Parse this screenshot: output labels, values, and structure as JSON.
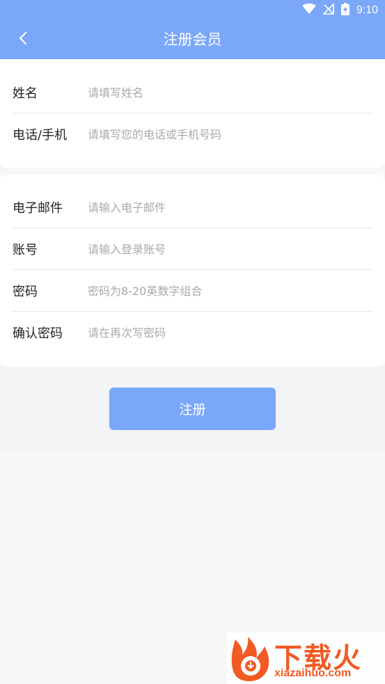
{
  "status": {
    "time": "9:10"
  },
  "header": {
    "title": "注册会员"
  },
  "form_section_1": {
    "name_label": "姓名",
    "name_placeholder": "请填写姓名",
    "phone_label": "电话/手机",
    "phone_placeholder": "请填写您的电话或手机号码"
  },
  "form_section_2": {
    "email_label": "电子邮件",
    "email_placeholder": "请输入电子邮件",
    "account_label": "账号",
    "account_placeholder": "请输入登录账号",
    "password_label": "密码",
    "password_placeholder": "密码为8-20英数字组合",
    "confirm_label": "确认密码",
    "confirm_placeholder": "请在再次写密码"
  },
  "actions": {
    "register_label": "注册"
  },
  "watermark": {
    "brand": "下载火",
    "domain": "xiazaihuo.com"
  },
  "icons": {
    "back": "back-arrow-icon",
    "wifi": "wifi-icon",
    "signal": "signal-off-icon",
    "battery": "battery-charging-icon"
  },
  "colors": {
    "accent": "#7aa7f7",
    "watermark": "#f25a23"
  }
}
